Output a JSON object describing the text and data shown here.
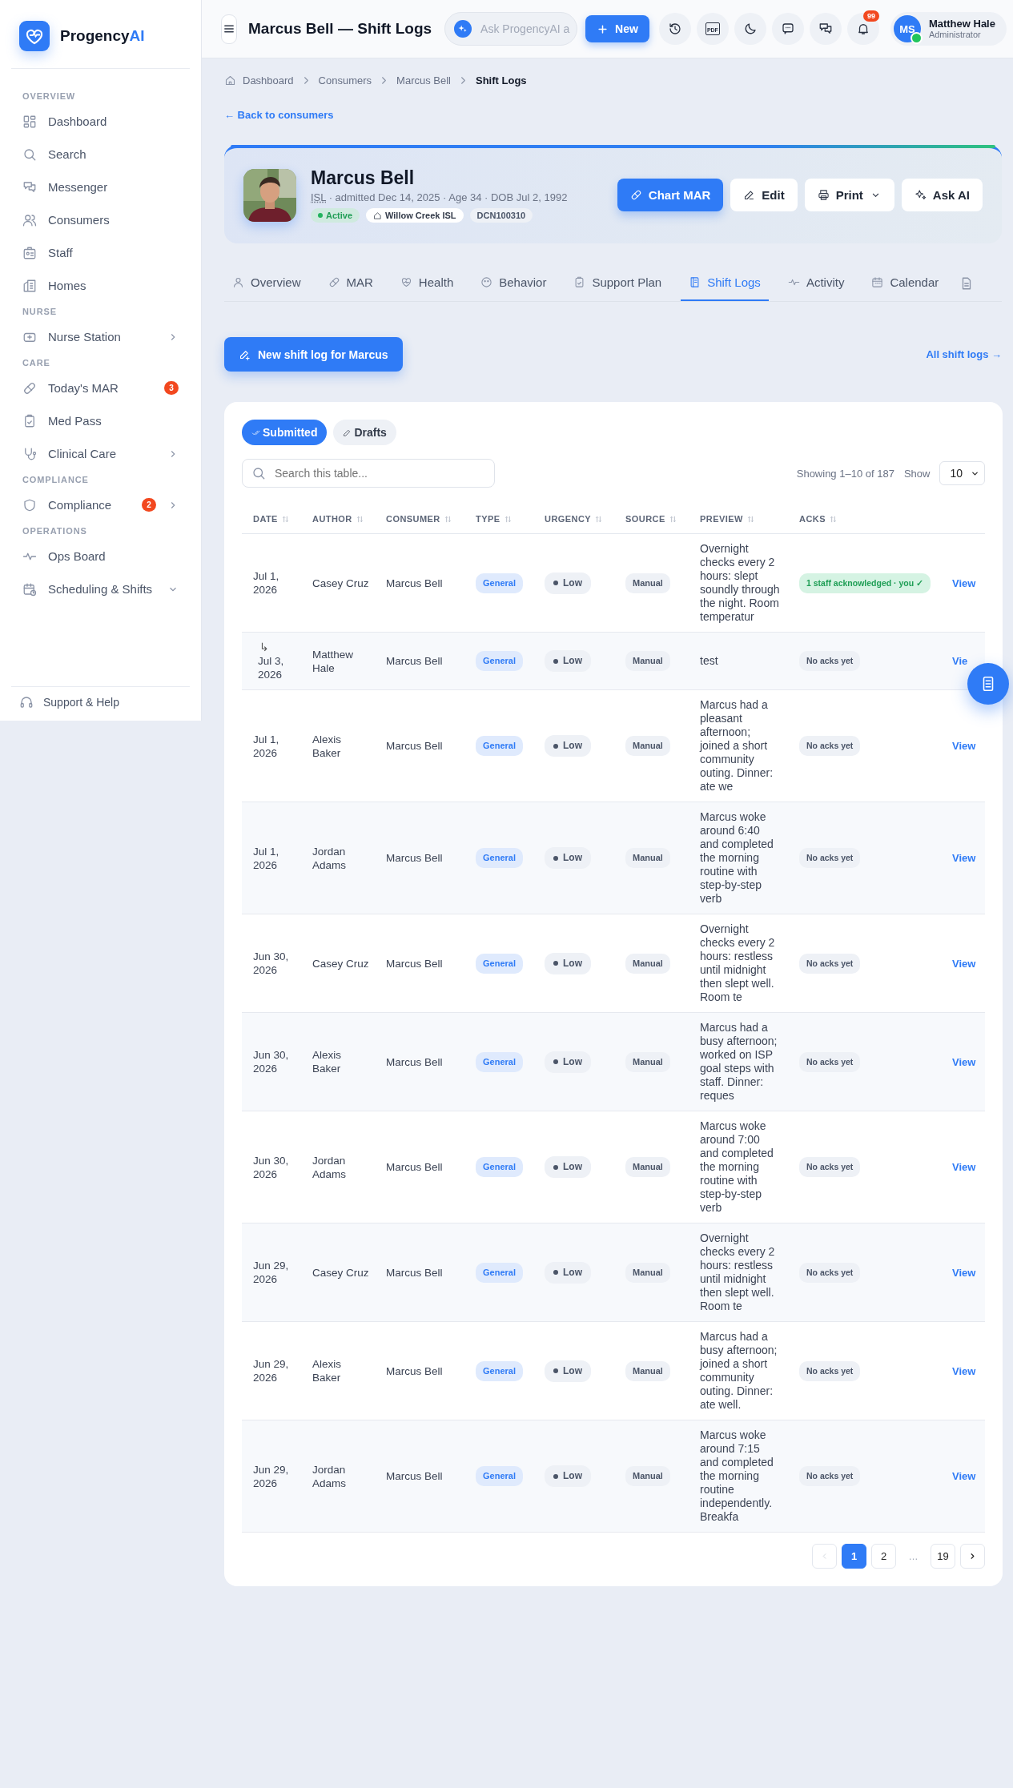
{
  "brand": {
    "name": "Progency",
    "suffix": "AI"
  },
  "sidebar": {
    "sections": [
      {
        "title": "OVERVIEW",
        "items": [
          {
            "label": "Dashboard",
            "kind": "link"
          },
          {
            "label": "Search",
            "kind": "link"
          },
          {
            "label": "Messenger",
            "kind": "link"
          },
          {
            "label": "Consumers",
            "kind": "link"
          },
          {
            "label": "Staff",
            "kind": "link"
          },
          {
            "label": "Homes",
            "kind": "link"
          }
        ]
      },
      {
        "title": "NURSE",
        "items": [
          {
            "label": "Nurse Station",
            "kind": "group",
            "expanded": false
          }
        ]
      },
      {
        "title": "CARE",
        "items": [
          {
            "label": "Today's MAR",
            "kind": "link",
            "badge": "3"
          },
          {
            "label": "Med Pass",
            "kind": "link"
          },
          {
            "label": "Clinical Care",
            "kind": "group",
            "expanded": false
          }
        ]
      },
      {
        "title": "COMPLIANCE",
        "items": [
          {
            "label": "Compliance",
            "kind": "group",
            "expanded": false,
            "badge": "2"
          }
        ]
      },
      {
        "title": "OPERATIONS",
        "items": [
          {
            "label": "Ops Board",
            "kind": "link"
          },
          {
            "label": "Scheduling & Shifts",
            "kind": "group",
            "expanded": true
          }
        ]
      }
    ],
    "footer": "Support & Help"
  },
  "header": {
    "title": "Marcus Bell — Shift Logs",
    "ask": {
      "placeholder": "Ask ProgencyAI a"
    },
    "new_button": "New",
    "pdf_label": "PDF",
    "notifications": "99",
    "user": {
      "initials": "MS",
      "name": "Matthew Hale",
      "role": "Administrator",
      "online": true
    }
  },
  "breadcrumb": [
    "Dashboard",
    "Consumers",
    "Marcus Bell",
    "Shift Logs"
  ],
  "back_link": "← Back to consumers",
  "profile": {
    "name": "Marcus Bell",
    "program": "ISL",
    "details": " · admitted Dec 14, 2025 · Age 34 · DOB Jul 2, 1992",
    "status": "Active",
    "home": "Willow Creek ISL",
    "id": "DCN100310",
    "actions": [
      {
        "label": "Chart MAR",
        "kind": "primary"
      },
      {
        "label": "Edit",
        "kind": "plain"
      },
      {
        "label": "Print",
        "kind": "menu"
      },
      {
        "label": "Ask AI",
        "kind": "plain"
      }
    ]
  },
  "tabs": [
    {
      "label": "Overview",
      "selected": false
    },
    {
      "label": "MAR",
      "selected": false
    },
    {
      "label": "Health",
      "selected": false
    },
    {
      "label": "Behavior",
      "selected": false
    },
    {
      "label": "Support Plan",
      "selected": false
    },
    {
      "label": "Shift Logs",
      "selected": true
    },
    {
      "label": "Activity",
      "selected": false
    },
    {
      "label": "Calendar",
      "selected": false
    }
  ],
  "new_log_button": "New shift log for Marcus",
  "all_logs_link": "All shift logs →",
  "table": {
    "filters": [
      {
        "label": "Submitted",
        "selected": true
      },
      {
        "label": "Drafts",
        "selected": false
      }
    ],
    "search": {
      "placeholder": "Search this table..."
    },
    "showing": "Showing 1–10 of 187",
    "show_label": "Show",
    "page_size": "10",
    "columns": [
      "DATE",
      "AUTHOR",
      "CONSUMER",
      "TYPE",
      "URGENCY",
      "SOURCE",
      "PREVIEW",
      "ACKS"
    ],
    "rows": [
      {
        "date": "Jul 1, 2026",
        "author": "Casey Cruz",
        "consumer": "Marcus Bell",
        "type": "General",
        "urgency": "Low",
        "source": "Manual",
        "preview": "Overnight checks every 2 hours: slept soundly through the night. Room temperatur",
        "acks": "1 staff acknowledged · you ✓",
        "acked": true,
        "action": "View"
      },
      {
        "prefix": "↳",
        "date": "Jul 3, 2026",
        "author": "Matthew Hale",
        "consumer": "Marcus Bell",
        "type": "General",
        "urgency": "Low",
        "source": "Manual",
        "preview": "test",
        "acks": "No acks yet",
        "acked": false,
        "action": "Vie"
      },
      {
        "date": "Jul 1, 2026",
        "author": "Alexis Baker",
        "consumer": "Marcus Bell",
        "type": "General",
        "urgency": "Low",
        "source": "Manual",
        "preview": "Marcus had a pleasant afternoon; joined a short community outing. Dinner: ate we",
        "acks": "No acks yet",
        "acked": false,
        "action": "View"
      },
      {
        "date": "Jul 1, 2026",
        "author": "Jordan Adams",
        "consumer": "Marcus Bell",
        "type": "General",
        "urgency": "Low",
        "source": "Manual",
        "preview": "Marcus woke around 6:40 and completed the morning routine with step-by-step verb",
        "acks": "No acks yet",
        "acked": false,
        "action": "View"
      },
      {
        "date": "Jun 30, 2026",
        "author": "Casey Cruz",
        "consumer": "Marcus Bell",
        "type": "General",
        "urgency": "Low",
        "source": "Manual",
        "preview": "Overnight checks every 2 hours: restless until midnight then slept well. Room te",
        "acks": "No acks yet",
        "acked": false,
        "action": "View"
      },
      {
        "date": "Jun 30, 2026",
        "author": "Alexis Baker",
        "consumer": "Marcus Bell",
        "type": "General",
        "urgency": "Low",
        "source": "Manual",
        "preview": "Marcus had a busy afternoon; worked on ISP goal steps with staff. Dinner: reques",
        "acks": "No acks yet",
        "acked": false,
        "action": "View"
      },
      {
        "date": "Jun 30, 2026",
        "author": "Jordan Adams",
        "consumer": "Marcus Bell",
        "type": "General",
        "urgency": "Low",
        "source": "Manual",
        "preview": "Marcus woke around 7:00 and completed the morning routine with step-by-step verb",
        "acks": "No acks yet",
        "acked": false,
        "action": "View"
      },
      {
        "date": "Jun 29, 2026",
        "author": "Casey Cruz",
        "consumer": "Marcus Bell",
        "type": "General",
        "urgency": "Low",
        "source": "Manual",
        "preview": "Overnight checks every 2 hours: restless until midnight then slept well. Room te",
        "acks": "No acks yet",
        "acked": false,
        "action": "View"
      },
      {
        "date": "Jun 29, 2026",
        "author": "Alexis Baker",
        "consumer": "Marcus Bell",
        "type": "General",
        "urgency": "Low",
        "source": "Manual",
        "preview": "Marcus had a busy afternoon; joined a short community outing. Dinner: ate well.",
        "acks": "No acks yet",
        "acked": false,
        "action": "View"
      },
      {
        "date": "Jun 29, 2026",
        "author": "Jordan Adams",
        "consumer": "Marcus Bell",
        "type": "General",
        "urgency": "Low",
        "source": "Manual",
        "preview": "Marcus woke around 7:15 and completed the morning routine independently. Breakfa",
        "acks": "No acks yet",
        "acked": false,
        "action": "View"
      }
    ],
    "pages": [
      {
        "label": "1",
        "selected": true
      },
      {
        "label": "2",
        "selected": false
      },
      {
        "label": "…",
        "kind": "gap"
      },
      {
        "label": "19",
        "selected": false
      }
    ],
    "prev_disabled": true
  }
}
